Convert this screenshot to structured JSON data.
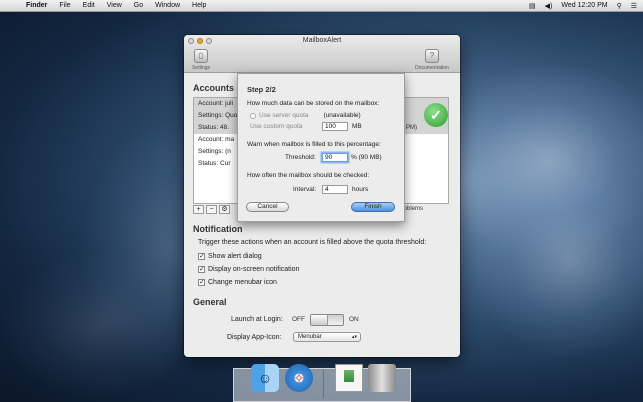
{
  "menubar": {
    "app": "Finder",
    "items": [
      "File",
      "Edit",
      "View",
      "Go",
      "Window",
      "Help"
    ],
    "clock": "Wed 12:20 PM",
    "icons": [
      "apple-icon",
      "volume-icon",
      "search-icon",
      "list-icon"
    ]
  },
  "window": {
    "title": "MailboxAlert",
    "toolbar_left_label": "Settings",
    "toolbar_right_label": "Documentation",
    "accounts_heading": "Accounts",
    "accounts": [
      {
        "account": "Account: juli",
        "settings": "Settings: Quo",
        "status": "Status: 48."
      },
      {
        "account": "Account: ma",
        "settings": "Settings: (n",
        "status": "Status: Cur"
      }
    ],
    "accounts_extra": "8 PM)",
    "accounts_problems": "nts, 0 problems",
    "notification_heading": "Notification",
    "notification_desc": "Trigger these actions when an account is filled above the quota threshold:",
    "checkboxes": [
      {
        "label": "Show alert dialog",
        "checked": true
      },
      {
        "label": "Display on-screen notification",
        "checked": true
      },
      {
        "label": "Change menubar icon",
        "checked": true
      }
    ],
    "general_heading": "General",
    "launch_label": "Launch at Login:",
    "off_label": "OFF",
    "on_label": "ON",
    "app_icon_label": "Display App-Icon:",
    "app_icon_value": "Menubar"
  },
  "sheet": {
    "step": "Step 2/2",
    "q_storage": "How much data can be stored on the mailbox:",
    "opt_server": "Use server quota",
    "opt_server_note": "(unavailable)",
    "opt_custom": "Use custom quota",
    "quota_value": "100",
    "quota_unit": "MB",
    "q_warn": "Warn when mailbox is filled to this percentage:",
    "threshold_label": "Threshold:",
    "threshold_value": "90",
    "threshold_unit": "%  (90 MB)",
    "q_check": "How often the mailbox should be checked:",
    "interval_label": "Interval:",
    "interval_value": "4",
    "interval_unit": "hours",
    "cancel": "Cancel",
    "finish": "Finish"
  },
  "colors": {
    "accent": "#4d93e0",
    "window_bg": "#ececec"
  }
}
